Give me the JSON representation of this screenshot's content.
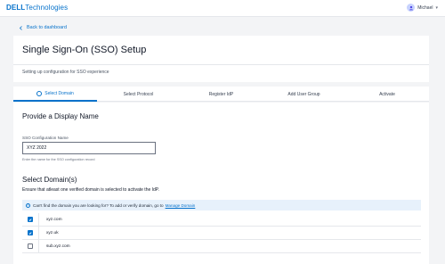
{
  "header": {
    "logo_bold": "DELL",
    "logo_rest": "Technologies",
    "user_name": "Michael"
  },
  "nav": {
    "back_label": "Back to dashboard"
  },
  "page": {
    "title": "Single Sign-On (SSO) Setup",
    "subtitle": "Setting up configuration for SSO experience"
  },
  "steps": [
    {
      "label": "Select Domain",
      "active": true
    },
    {
      "label": "Select Protocol",
      "active": false
    },
    {
      "label": "Register IdP",
      "active": false
    },
    {
      "label": "Add User Group",
      "active": false
    },
    {
      "label": "Activate",
      "active": false
    }
  ],
  "form": {
    "display_heading": "Provide a Display Name",
    "config_label": "SSO Configuration Name",
    "config_value": "XYZ 2022",
    "config_helper": "Enter the name for the SSO configuration record",
    "domains_heading": "Select Domain(s)",
    "domains_note": "Ensure that atleast one verified domain is selected to activate the IdP.",
    "info_text": "Can't find the domain you are looking for? To add or verify domain, go to",
    "info_link": "Manage Domain",
    "domains": [
      {
        "name": "xyz.com",
        "checked": true
      },
      {
        "name": "xyz.uk",
        "checked": true
      },
      {
        "name": "sub.xyz.com",
        "checked": false
      }
    ]
  },
  "colors": {
    "accent": "#0672cb",
    "info_bg": "#e7f1fb",
    "page_bg": "#f3f4f6"
  },
  "icons": {
    "back": "chevron-left-icon",
    "info": "info-icon",
    "user": "user-avatar-icon",
    "step": "step-circle-icon",
    "check": "check-icon"
  }
}
